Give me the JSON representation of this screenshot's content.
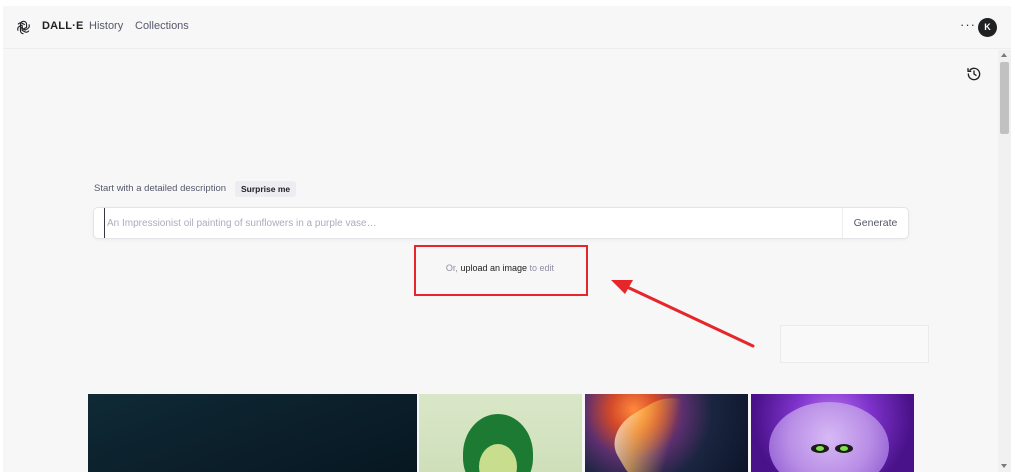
{
  "header": {
    "brand": "DALL·E",
    "nav": [
      "History",
      "Collections"
    ],
    "more_label": "···",
    "avatar_initial": "K"
  },
  "prompt": {
    "intro": "Start with a detailed description",
    "surprise_label": "Surprise me",
    "placeholder": "An Impressionist oil painting of sunflowers in a purple vase…",
    "value": "",
    "generate_label": "Generate"
  },
  "upload": {
    "prefix": "Or,",
    "link": "upload an image",
    "suffix": "to edit"
  },
  "gallery": [
    {
      "icon": "dark-teal-image"
    },
    {
      "icon": "avocado-image"
    },
    {
      "icon": "colorful-splash-image"
    },
    {
      "icon": "purple-monster-image"
    }
  ],
  "colors": {
    "annotation": "#e5262b",
    "background": "#f7f7f8",
    "text": "#202123"
  }
}
